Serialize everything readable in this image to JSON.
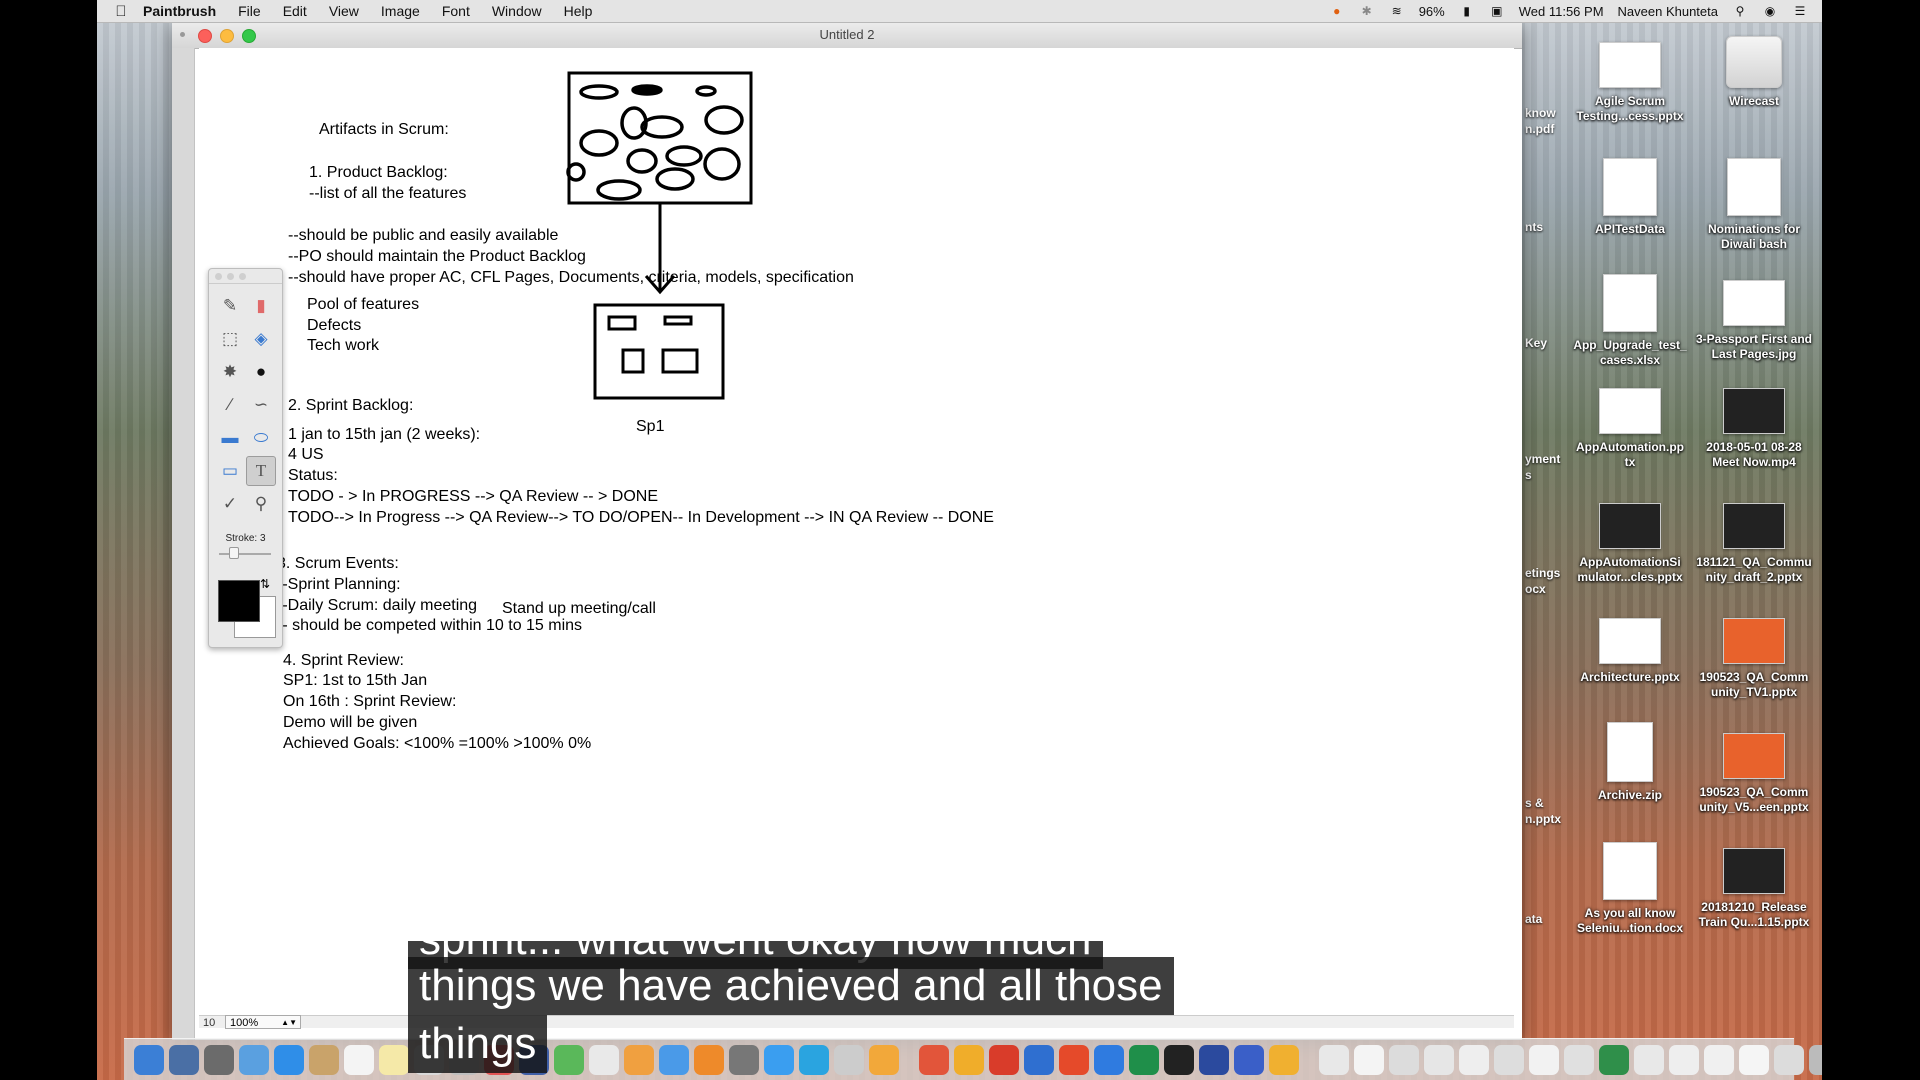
{
  "menubar": {
    "app_name": "Paintbrush",
    "menus": [
      "File",
      "Edit",
      "View",
      "Image",
      "Font",
      "Window",
      "Help"
    ],
    "battery": "96%",
    "clock": "Wed 11:56 PM",
    "user": "Naveen Khunteta"
  },
  "window": {
    "title": "Untitled 2",
    "zoom": "100%",
    "left_value": "10"
  },
  "palette": {
    "stroke_label": "Stroke: 3",
    "selected_tool": "text",
    "foreground_color": "#000000",
    "background_color": "#ffffff"
  },
  "canvas_text": {
    "artifacts_title": "Artifacts in Scrum:",
    "pb_title": "1. Product Backlog:",
    "pb_desc": "--list of all the features",
    "pb_rule1": "--should be public and easily available",
    "pb_rule2": "--PO should maintain the Product Backlog",
    "pb_rule3": "--should have proper AC, CFL Pages, Documents, criteria, models, specification",
    "pool1": "Pool of features",
    "pool2": "Defects",
    "pool3": "Tech work",
    "sb_title": "2. Sprint Backlog:",
    "sp1_label": "Sp1",
    "sb_l1": "1 jan to 15th jan (2 weeks):",
    "sb_l2": "4 US",
    "sb_l3": "Status:",
    "sb_l4": "TODO - > In PROGRESS --> QA Review -- > DONE",
    "sb_l5": "TODO--> In Progress --> QA Review--> TO DO/OPEN--  In Development --> IN QA Review -- DONE",
    "se_title": "3. Scrum Events:",
    "se_l1": "--Sprint Planning:",
    "se_l2": "--Daily Scrum: daily meeting",
    "se_standup": "Stand up meeting/call",
    "se_l3": "-- should be competed within 10 to 15 mins",
    "sr_title": "4. Sprint Review:",
    "sr_l1": "SP1: 1st to 15th Jan",
    "sr_l2": "On 16th : Sprint Review:",
    "sr_l3": "Demo will be given",
    "sr_l4": "Achieved Goals: <100% =100% >100% 0%"
  },
  "desktop": {
    "cut_labels": [
      "know",
      "n.pdf",
      "nts",
      "Key",
      "yment",
      "s",
      "etings",
      "ocx",
      "s &",
      "n.pptx",
      "ata"
    ],
    "icons": [
      {
        "label": "Agile Scrum Testing...cess.pptx",
        "kind": "wide"
      },
      {
        "label": "Wirecast",
        "kind": "drive"
      },
      {
        "label": "APITestData",
        "kind": "doc"
      },
      {
        "label": "Nominations for Diwali bash",
        "kind": "doc"
      },
      {
        "label": "App_Upgrade_test_ cases.xlsx",
        "kind": "doc"
      },
      {
        "label": "3-Passport First and Last Pages.jpg",
        "kind": "wide"
      },
      {
        "label": "AppAutomation.pp tx",
        "kind": "wide"
      },
      {
        "label": "2018-05-01 08-28 Meet Now.mp4",
        "kind": "dark"
      },
      {
        "label": "AppAutomationSi mulator...cles.pptx",
        "kind": "dark"
      },
      {
        "label": "181121_QA_Commu nity_draft_2.pptx",
        "kind": "dark"
      },
      {
        "label": "Architecture.pptx",
        "kind": "wide"
      },
      {
        "label": "190523_QA_Comm unity_TV1.pptx",
        "kind": "orange"
      },
      {
        "label": "Archive.zip",
        "kind": "zip"
      },
      {
        "label": "190523_QA_Comm unity_V5...een.pptx",
        "kind": "orange"
      },
      {
        "label": "As you all know Seleniu...tion.docx",
        "kind": "doc"
      },
      {
        "label": "20181210_Release Train Qu...1.15.pptx",
        "kind": "dark"
      }
    ]
  },
  "subtitle": {
    "line1": "sprint... what went okay how much",
    "line2": "things we have achieved and all those",
    "line3": "things"
  },
  "dock": {
    "colors": [
      "#3b7fd6",
      "#4a6fa5",
      "#6b6b6b",
      "#5aa0e0",
      "#2f8ee8",
      "#c9a36a",
      "#f4f4f4",
      "#f5e9a8",
      "#d9d9d9",
      "#bfbfbf",
      "#e35454",
      "#3f5fa8",
      "#5ab85a",
      "#e9e9e9",
      "#f0a040",
      "#4a9ae8",
      "#ee8a2a",
      "#777777",
      "#3a9ef0",
      "#2aa4e0",
      "#cccccc",
      "#f2a83a",
      "#e2553a",
      "#f0ad2a",
      "#d93c2a",
      "#2f6fd0",
      "#e54a2a",
      "#2f7be0",
      "#1f8f4a",
      "#222222",
      "#2b4a9e",
      "#3a5fc8",
      "#f0b030",
      "#e8e8e8",
      "#f4f4f4",
      "#dcdcdc",
      "#e6e6e6",
      "#eeeeee",
      "#dddddd",
      "#f2f2f2",
      "#e0e0e0",
      "#2f8f4a",
      "#e8e8e8",
      "#eeeeee",
      "#f0f0f0",
      "#f5f5f5",
      "#dcdcdc",
      "#bbbbbb"
    ]
  }
}
